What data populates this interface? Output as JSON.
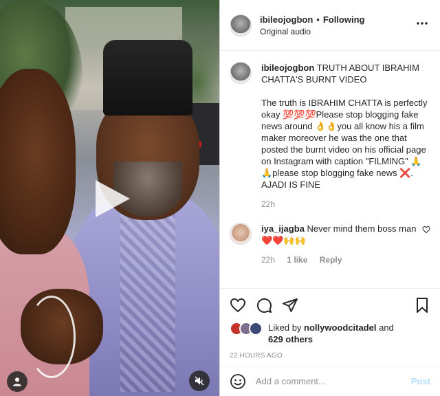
{
  "post": {
    "username": "ibileojogbon",
    "separator": "•",
    "follow_state": "Following",
    "audio": "Original audio",
    "more_icon": "more-horizontal-icon"
  },
  "caption": {
    "username": "ibileojogbon",
    "title": "TRUTH ABOUT IBRAHIM CHATTA'S BURNT VIDEO",
    "body": "The truth is IBRAHIM CHATTA is perfectly okay 💯💯💯Please stop blogging fake news around 👌👌you all know his a film maker moreover he was the one that posted the burnt video on his official page on Instagram with caption \"FILMING\" 🙏🙏please stop blogging fake news ❌. AJADI IS FINE",
    "time": "22h"
  },
  "comments": [
    {
      "username": "iya_ijagba",
      "text": "Never mind them boss man ❤️❤️🙌🙌",
      "time": "22h",
      "likes": "1 like",
      "reply": "Reply"
    }
  ],
  "likes": {
    "prefix": "Liked by",
    "user": "nollywoodcitadel",
    "and": "and",
    "others": "629 others"
  },
  "timestamp": "22 HOURS AGO",
  "add_comment": {
    "placeholder": "Add a comment...",
    "post_label": "Post"
  },
  "colors": {
    "accent_disabled": "#b2dffc",
    "text": "#262626",
    "secondary": "#8e8e8e",
    "border": "#dbdbdb"
  }
}
